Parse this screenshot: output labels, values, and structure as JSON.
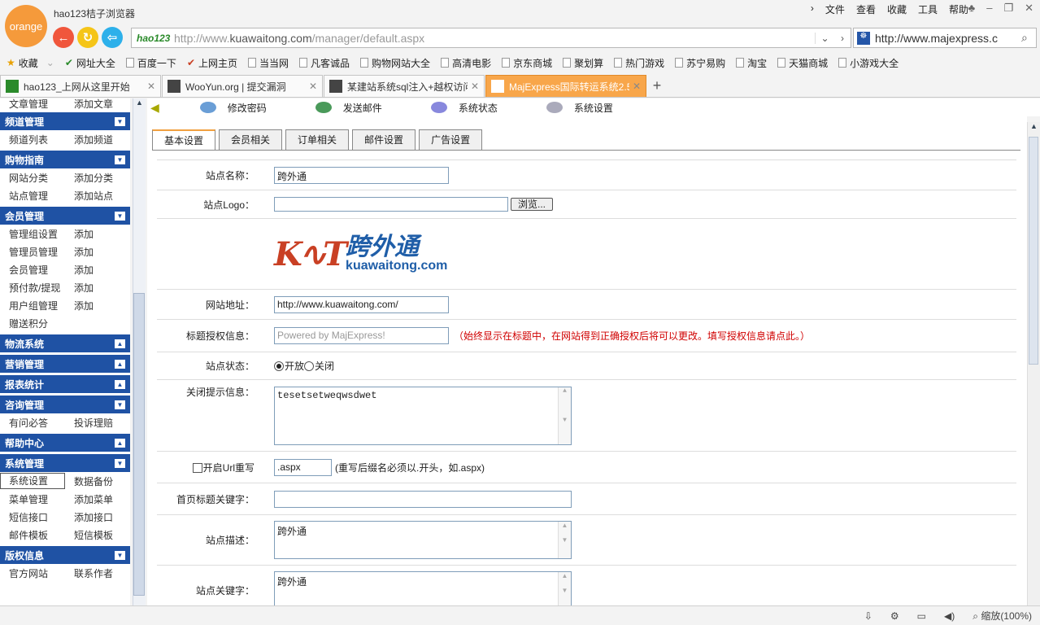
{
  "browser": {
    "logo": "orange",
    "title": "hao123桔子浏览器",
    "menu": [
      "文件",
      "查看",
      "收藏",
      "工具",
      "帮助"
    ],
    "address": {
      "brand": "hao123",
      "url_prefix": "http://www.",
      "url_domain": "kuawaitong.com",
      "url_path": "/manager/default.aspx"
    },
    "search_address": "http://www.majexpress.c",
    "bookmarks": [
      "收藏",
      "网址大全",
      "百度一下",
      "上网主页",
      "当当网",
      "凡客诚品",
      "购物网站大全",
      "高清电影",
      "京东商城",
      "聚划算",
      "热门游戏",
      "苏宁易购",
      "淘宝",
      "天猫商城",
      "小游戏大全"
    ],
    "tabs": [
      {
        "title": "hao123_上网从这里开始"
      },
      {
        "title": "WooYun.org | 提交漏洞"
      },
      {
        "title": "某建站系统sql注入+越权访问"
      },
      {
        "title": "MajExpress国际转运系统2.5"
      }
    ],
    "zoom": "缩放(100%)"
  },
  "sidebar": {
    "top": [
      "文章管理",
      "添加文章"
    ],
    "groups": [
      {
        "title": "频道管理",
        "rows": [
          [
            "频道列表",
            "添加频道"
          ]
        ]
      },
      {
        "title": "购物指南",
        "rows": [
          [
            "网站分类",
            "添加分类"
          ],
          [
            "站点管理",
            "添加站点"
          ]
        ]
      },
      {
        "title": "会员管理",
        "rows": [
          [
            "管理组设置",
            "添加"
          ],
          [
            "管理员管理",
            "添加"
          ],
          [
            "会员管理",
            "添加"
          ],
          [
            "预付款/提现",
            "添加"
          ],
          [
            "用户组管理",
            "添加"
          ],
          [
            "赠送积分",
            ""
          ]
        ]
      },
      {
        "title": "物流系统",
        "rows": []
      },
      {
        "title": "营销管理",
        "rows": []
      },
      {
        "title": "报表统计",
        "rows": []
      },
      {
        "title": "咨询管理",
        "rows": [
          [
            "有问必答",
            "投诉理赔"
          ]
        ]
      },
      {
        "title": "帮助中心",
        "rows": []
      },
      {
        "title": "系统管理",
        "rows": [
          [
            "系统设置",
            "数据备份"
          ],
          [
            "菜单管理",
            "添加菜单"
          ],
          [
            "短信接口",
            "添加接口"
          ],
          [
            "邮件模板",
            "短信模板"
          ]
        ]
      },
      {
        "title": "版权信息",
        "rows": [
          [
            "官方网站",
            "联系作者"
          ]
        ]
      }
    ]
  },
  "toolbar": [
    "修改密码",
    "发送邮件",
    "系统状态",
    "系统设置"
  ],
  "content": {
    "tabs": [
      "基本设置",
      "会员相关",
      "订单相关",
      "邮件设置",
      "广告设置"
    ],
    "site_name_label": "站点名称：",
    "site_name": "跨外通",
    "logo_label": "站点Logo：",
    "browse": "浏览...",
    "logo_cn": "跨外通",
    "logo_en": "kuawaitong.com",
    "url_label": "网站地址：",
    "url_value": "http://www.kuawaitong.com/",
    "auth_label": "标题授权信息：",
    "auth_placeholder": "Powered by MajExpress!",
    "auth_note": "（始终显示在标题中，在网站得到正确授权后将可以更改。填写授权信息请点此。）",
    "status_label": "站点状态：",
    "status_open": "开放",
    "status_close": "关闭",
    "close_msg_label": "关闭提示信息：",
    "close_msg": "tesetsetweqwsdwet",
    "url_rewrite_label": "开启Url重写",
    "rewrite_ext": ".aspx",
    "rewrite_note": "(重写后缀名必须以.开头，如.aspx)",
    "home_kw_label": "首页标题关键字：",
    "desc_label": "站点描述：",
    "desc": "跨外通",
    "kw_label": "站点关键字：",
    "kw": "跨外通"
  }
}
